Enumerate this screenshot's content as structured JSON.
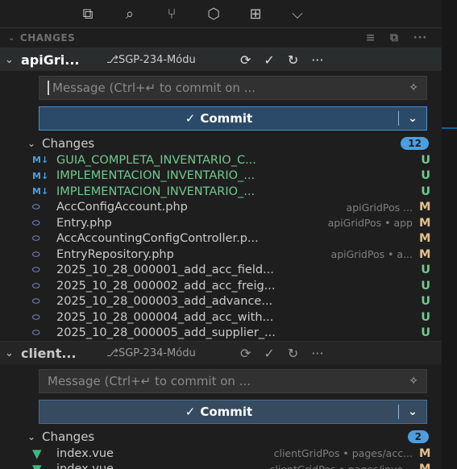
{
  "activity_icons": [
    "copy-icon",
    "search-icon",
    "source-control-icon",
    "extensions-icon",
    "remote-explorer-icon",
    "chevron-down-icon"
  ],
  "section": {
    "title": "CHANGES",
    "actions": [
      "≡",
      "⧉",
      "···"
    ]
  },
  "repos": [
    {
      "name": "apiGri...",
      "branch": "⎇SGP-234-Módu",
      "message_placeholder": "Message (Ctrl+↵ to commit on ...",
      "commit_label": "Commit",
      "changes_label": "Changes",
      "changes_count": "12",
      "files": [
        {
          "name": "GUIA_COMPLETA_INVENTARIO_C...",
          "path": "",
          "status": "U",
          "icon": "markdown-icon",
          "untracked": true
        },
        {
          "name": "IMPLEMENTACION_INVENTARIO_...",
          "path": "",
          "status": "U",
          "icon": "markdown-icon",
          "untracked": true
        },
        {
          "name": "IMPLEMENTACION_INVENTARIO_...",
          "path": "",
          "status": "U",
          "icon": "markdown-icon",
          "untracked": true
        },
        {
          "name": "AccConfigAccount.php",
          "path": "apiGridPos ...",
          "status": "M",
          "icon": "php-icon",
          "untracked": false
        },
        {
          "name": "Entry.php",
          "path": "apiGridPos • app",
          "status": "M",
          "icon": "php-icon",
          "untracked": false
        },
        {
          "name": "AccAccountingConfigController.p...",
          "path": "",
          "status": "M",
          "icon": "php-icon",
          "untracked": false
        },
        {
          "name": "EntryRepository.php",
          "path": "apiGridPos • a...",
          "status": "M",
          "icon": "php-icon",
          "untracked": false
        },
        {
          "name": "2025_10_28_000001_add_acc_field...",
          "path": "",
          "status": "U",
          "icon": "php-icon",
          "untracked": false
        },
        {
          "name": "2025_10_28_000002_add_acc_freig...",
          "path": "",
          "status": "U",
          "icon": "php-icon",
          "untracked": false
        },
        {
          "name": "2025_10_28_000003_add_advance...",
          "path": "",
          "status": "U",
          "icon": "php-icon",
          "untracked": false
        },
        {
          "name": "2025_10_28_000004_add_acc_with...",
          "path": "",
          "status": "U",
          "icon": "php-icon",
          "untracked": false
        },
        {
          "name": "2025_10_28_000005_add_supplier_...",
          "path": "",
          "status": "U",
          "icon": "php-icon",
          "untracked": false
        }
      ]
    },
    {
      "name": "client...",
      "branch": "⎇SGP-234-Módu",
      "message_placeholder": "Message (Ctrl+↵ to commit on ...",
      "commit_label": "Commit",
      "changes_label": "Changes",
      "changes_count": "2",
      "files": [
        {
          "name": "index.vue",
          "path": "clientGridPos • pages/acc...",
          "status": "M",
          "icon": "vue-icon",
          "untracked": false
        },
        {
          "name": "index.vue",
          "path": "clientGridPos • pages/inve...",
          "status": "M",
          "icon": "vue-icon",
          "untracked": false
        }
      ]
    }
  ],
  "colors": {
    "accent": "#4d9ee0",
    "untracked": "#73c991",
    "modified": "#e2c08d",
    "background": "#1e1e1e"
  }
}
